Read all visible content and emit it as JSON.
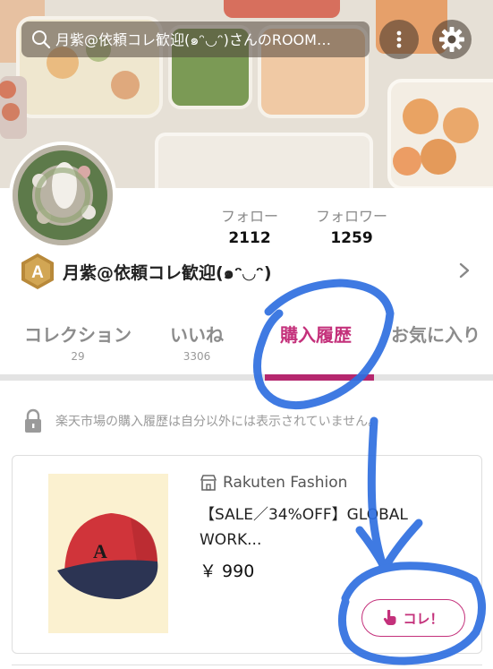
{
  "search": {
    "query": "月紫@依頼コレ歓迎(๑ᵔ◡ᵔ)さんのROOM…"
  },
  "profile": {
    "display_name": "月紫@依頼コレ歓迎(๑ᵔ◡ᵔ)",
    "rank_letter": "A",
    "stats": [
      {
        "label": "フォロー",
        "value": "2112"
      },
      {
        "label": "フォロワー",
        "value": "1259"
      }
    ]
  },
  "tabs": [
    {
      "label": "コレクション",
      "count": "29",
      "active": false
    },
    {
      "label": "いいね",
      "count": "3306",
      "active": false
    },
    {
      "label": "購入履歴",
      "count": "",
      "active": true
    },
    {
      "label": "お気に入り",
      "count": "",
      "active": false
    }
  ],
  "notice": {
    "text": "楽天市場の購入履歴は自分以外には表示されていません。"
  },
  "product": {
    "shop_name": "Rakuten Fashion",
    "title_line1": "【SALE／34%OFF】GLOBAL",
    "title_line2": "WORK...",
    "price": "￥ 990",
    "kore_label": "コレ！"
  },
  "colors": {
    "accent": "#c4317b",
    "rank_badge": "#b8893a",
    "annotation": "#2f6fe0"
  },
  "icons": [
    "search-icon",
    "more-vertical-icon",
    "gear-icon",
    "chevron-right-icon",
    "lock-icon",
    "shop-icon",
    "hand-pointer-icon"
  ]
}
